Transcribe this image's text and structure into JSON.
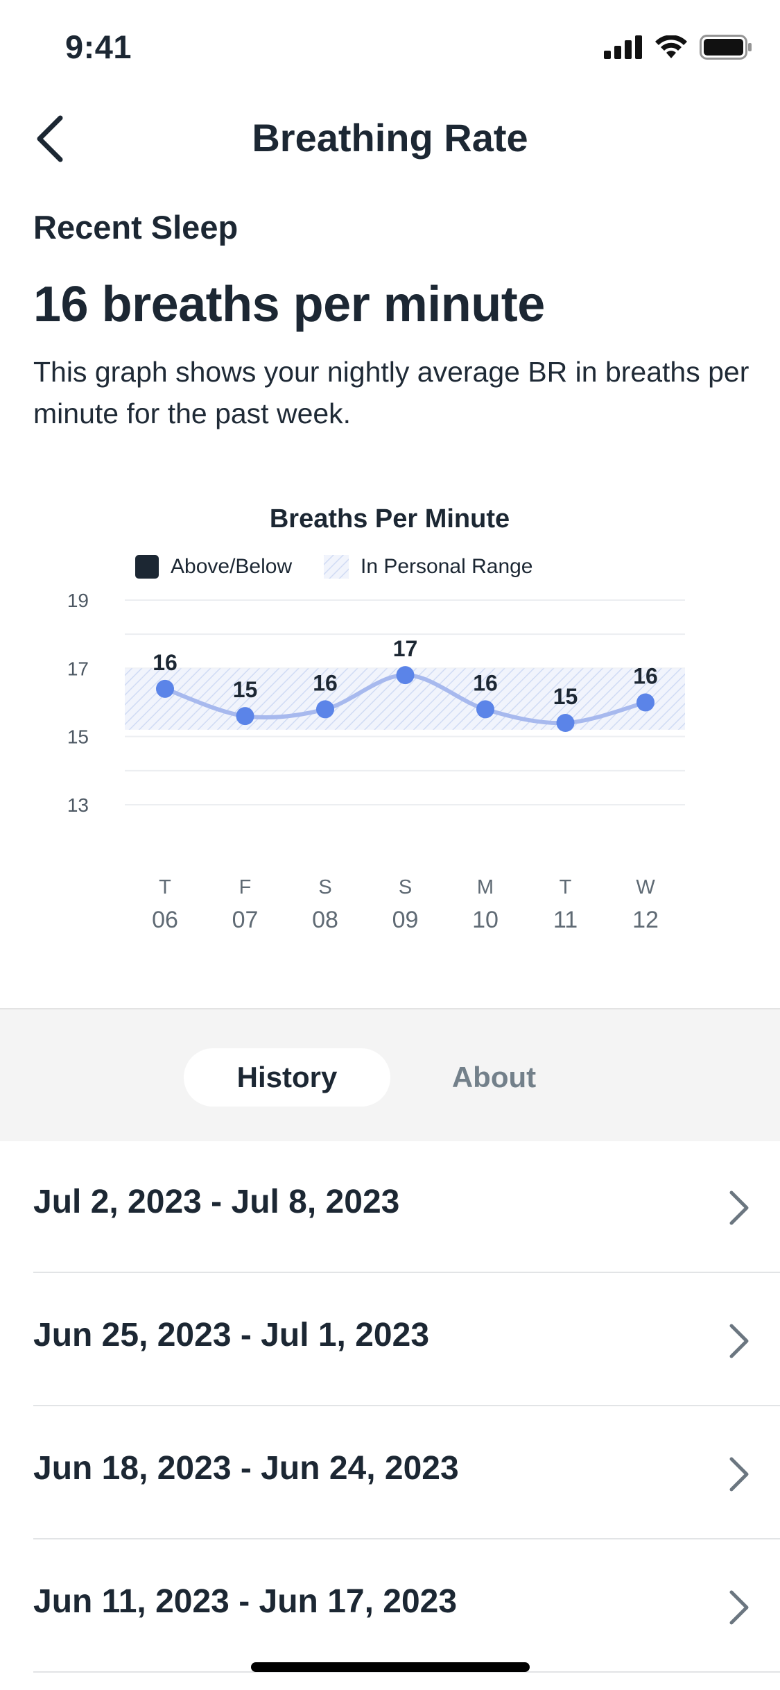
{
  "status_bar": {
    "time": "9:41"
  },
  "nav": {
    "title": "Breathing Rate",
    "back_icon": "chevron-left-icon"
  },
  "summary": {
    "section_label": "Recent Sleep",
    "value": "16 breaths per minute",
    "description": "This graph shows your nightly average BR in breaths per minute for the past week."
  },
  "chart_data": {
    "type": "line",
    "title": "Breaths Per Minute",
    "legend": [
      {
        "label": "Above/Below",
        "color": "#1c2733",
        "style": "solid"
      },
      {
        "label": "In Personal Range",
        "color": "#c9d6f3",
        "style": "hatched"
      }
    ],
    "y_ticks": [
      "19",
      "17",
      "15",
      "13"
    ],
    "ylim": [
      13,
      19
    ],
    "personal_range": [
      15.2,
      17.0
    ],
    "x_days": [
      "T",
      "F",
      "S",
      "S",
      "M",
      "T",
      "W"
    ],
    "x_dates": [
      "06",
      "07",
      "08",
      "09",
      "10",
      "11",
      "12"
    ],
    "values": [
      16.4,
      15.6,
      15.8,
      16.8,
      15.8,
      15.4,
      16.0
    ],
    "data_labels": [
      "16",
      "15",
      "16",
      "17",
      "16",
      "15",
      "16"
    ],
    "line_color": "#a7b9ee",
    "point_color": "#5b84e8"
  },
  "tabs": [
    {
      "label": "History",
      "active": true
    },
    {
      "label": "About",
      "active": false
    }
  ],
  "history": [
    {
      "label": "Jul 2, 2023 - Jul 8, 2023"
    },
    {
      "label": "Jun 25, 2023 - Jul 1, 2023"
    },
    {
      "label": "Jun 18, 2023 - Jun 24, 2023"
    },
    {
      "label": "Jun 11, 2023 - Jun 17, 2023"
    }
  ],
  "colors": {
    "text": "#1c2733",
    "muted": "#73808a",
    "segment_bg": "#f4f4f4"
  }
}
